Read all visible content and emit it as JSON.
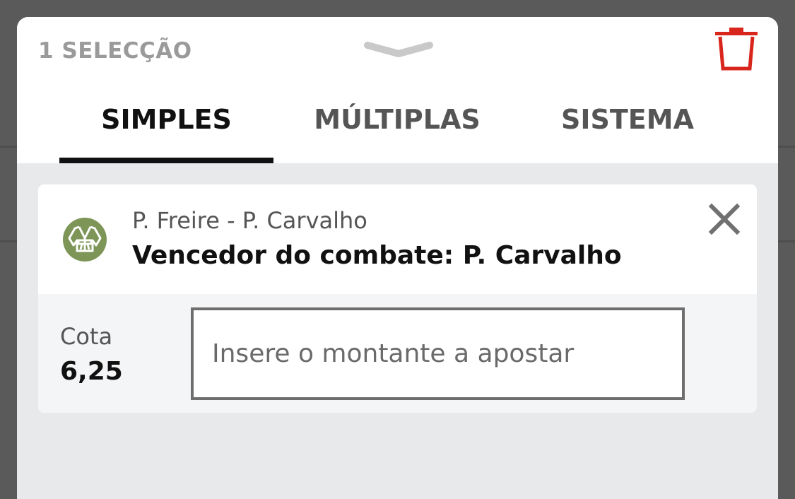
{
  "betslip": {
    "selection_count_label": "1 SELECÇÃO",
    "tabs": [
      {
        "label": "SIMPLES",
        "active": true
      },
      {
        "label": "MÚLTIPLAS",
        "active": false
      },
      {
        "label": "SISTEMA",
        "active": false
      }
    ],
    "bet": {
      "sport_icon": "judo-gi-icon",
      "event": "P. Freire - P. Carvalho",
      "market": "Vencedor do combate: P. Carvalho",
      "odds_label": "Cota",
      "odds_value": "6,25",
      "stake_placeholder": "Insere o montante a apostar",
      "stake_value": ""
    }
  },
  "colors": {
    "accent_delete": "#d9261c",
    "tab_active": "#111111",
    "tab_inactive": "#555555",
    "sport_icon_bg": "#7d9557"
  }
}
